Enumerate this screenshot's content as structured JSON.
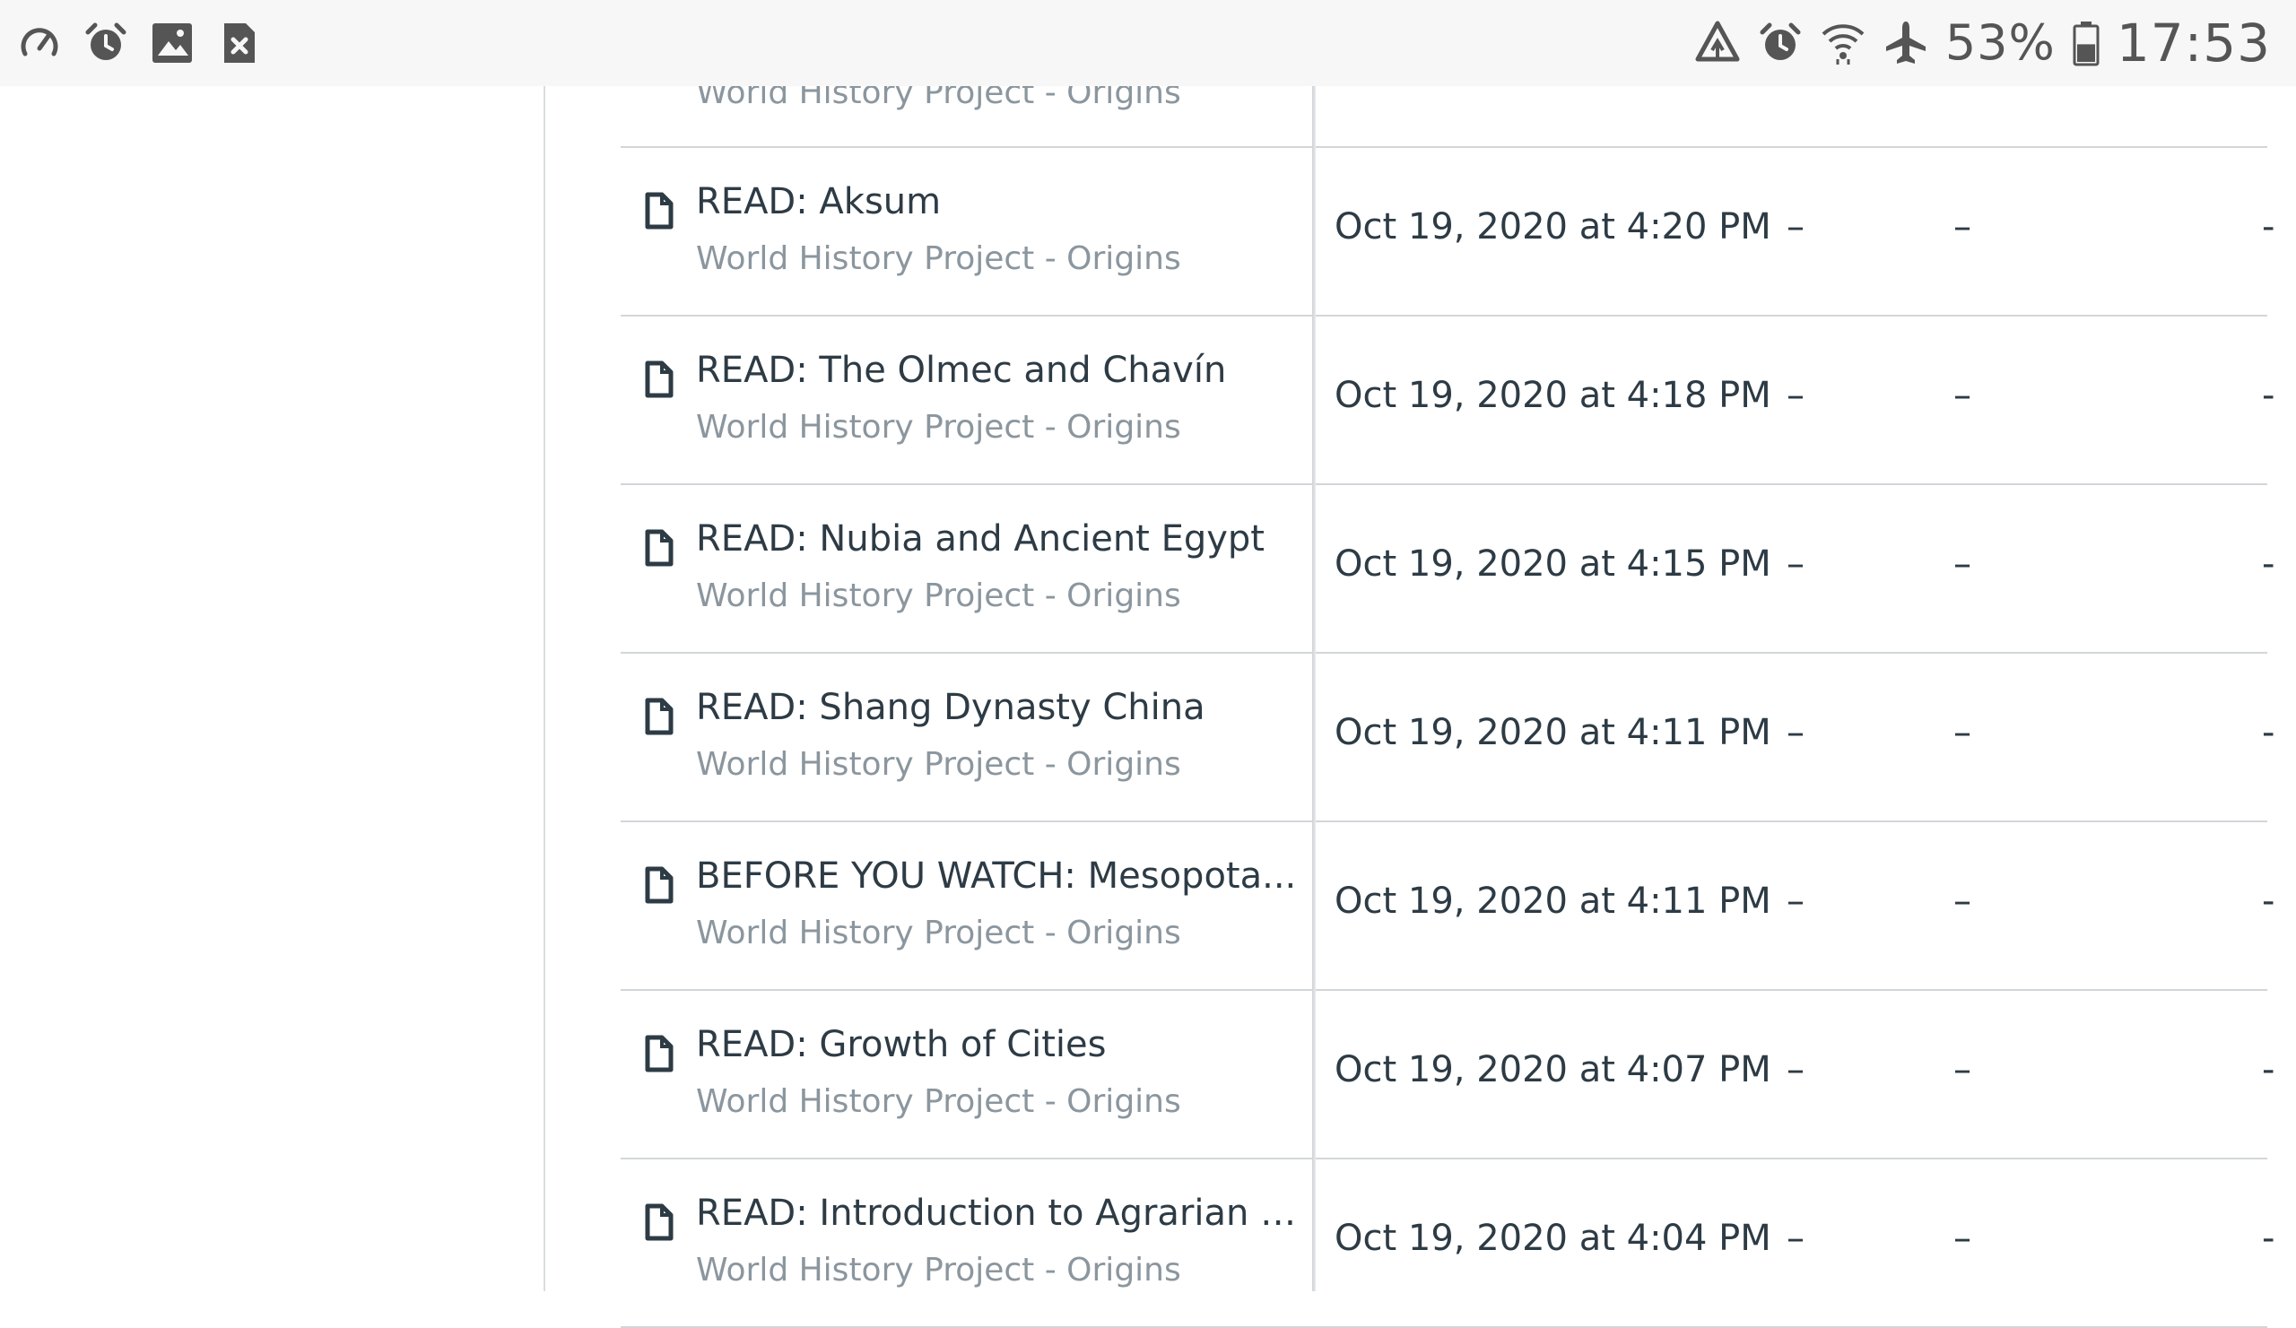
{
  "status_bar": {
    "left_icons": [
      "speedometer-icon",
      "alarm-icon",
      "image-icon",
      "sim-error-icon"
    ],
    "right_icons": [
      "data-saver-icon",
      "alarm-icon",
      "wifi-icon",
      "airplane-icon"
    ],
    "battery_percent": "53%",
    "battery_level": 0.53,
    "time": "17:53"
  },
  "list": {
    "top_partial_subtitle": "World History Project - Origins",
    "rows": [
      {
        "title": "READ: Aksum",
        "subtitle": "World History Project - Origins",
        "date": "Oct 19, 2020 at 4:20 PM",
        "col2": "–",
        "col3": "–",
        "col4": "-"
      },
      {
        "title": "READ: The Olmec and Chavín",
        "subtitle": "World History Project - Origins",
        "date": "Oct 19, 2020 at 4:18 PM",
        "col2": "–",
        "col3": "–",
        "col4": "-"
      },
      {
        "title": "READ: Nubia and Ancient Egypt",
        "subtitle": "World History Project - Origins",
        "date": "Oct 19, 2020 at 4:15 PM",
        "col2": "–",
        "col3": "–",
        "col4": "-"
      },
      {
        "title": "READ: Shang Dynasty China",
        "subtitle": "World History Project - Origins",
        "date": "Oct 19, 2020 at 4:11 PM",
        "col2": "–",
        "col3": "–",
        "col4": "-"
      },
      {
        "title": "BEFORE YOU WATCH: Mesopota...",
        "subtitle": "World History Project - Origins",
        "date": "Oct 19, 2020 at 4:11 PM",
        "col2": "–",
        "col3": "–",
        "col4": "-"
      },
      {
        "title": "READ: Growth of Cities",
        "subtitle": "World History Project - Origins",
        "date": "Oct 19, 2020 at 4:07 PM",
        "col2": "–",
        "col3": "–",
        "col4": "-"
      },
      {
        "title": "READ: Introduction to Agrarian So...",
        "subtitle": "World History Project - Origins",
        "date": "Oct 19, 2020 at 4:04 PM",
        "col2": "–",
        "col3": "–",
        "col4": "-"
      }
    ]
  },
  "colors": {
    "status_bar_bg": "#f7f7f7",
    "text_primary": "#2d3b45",
    "text_secondary": "#8b969e",
    "divider": "#d2d6d9"
  }
}
